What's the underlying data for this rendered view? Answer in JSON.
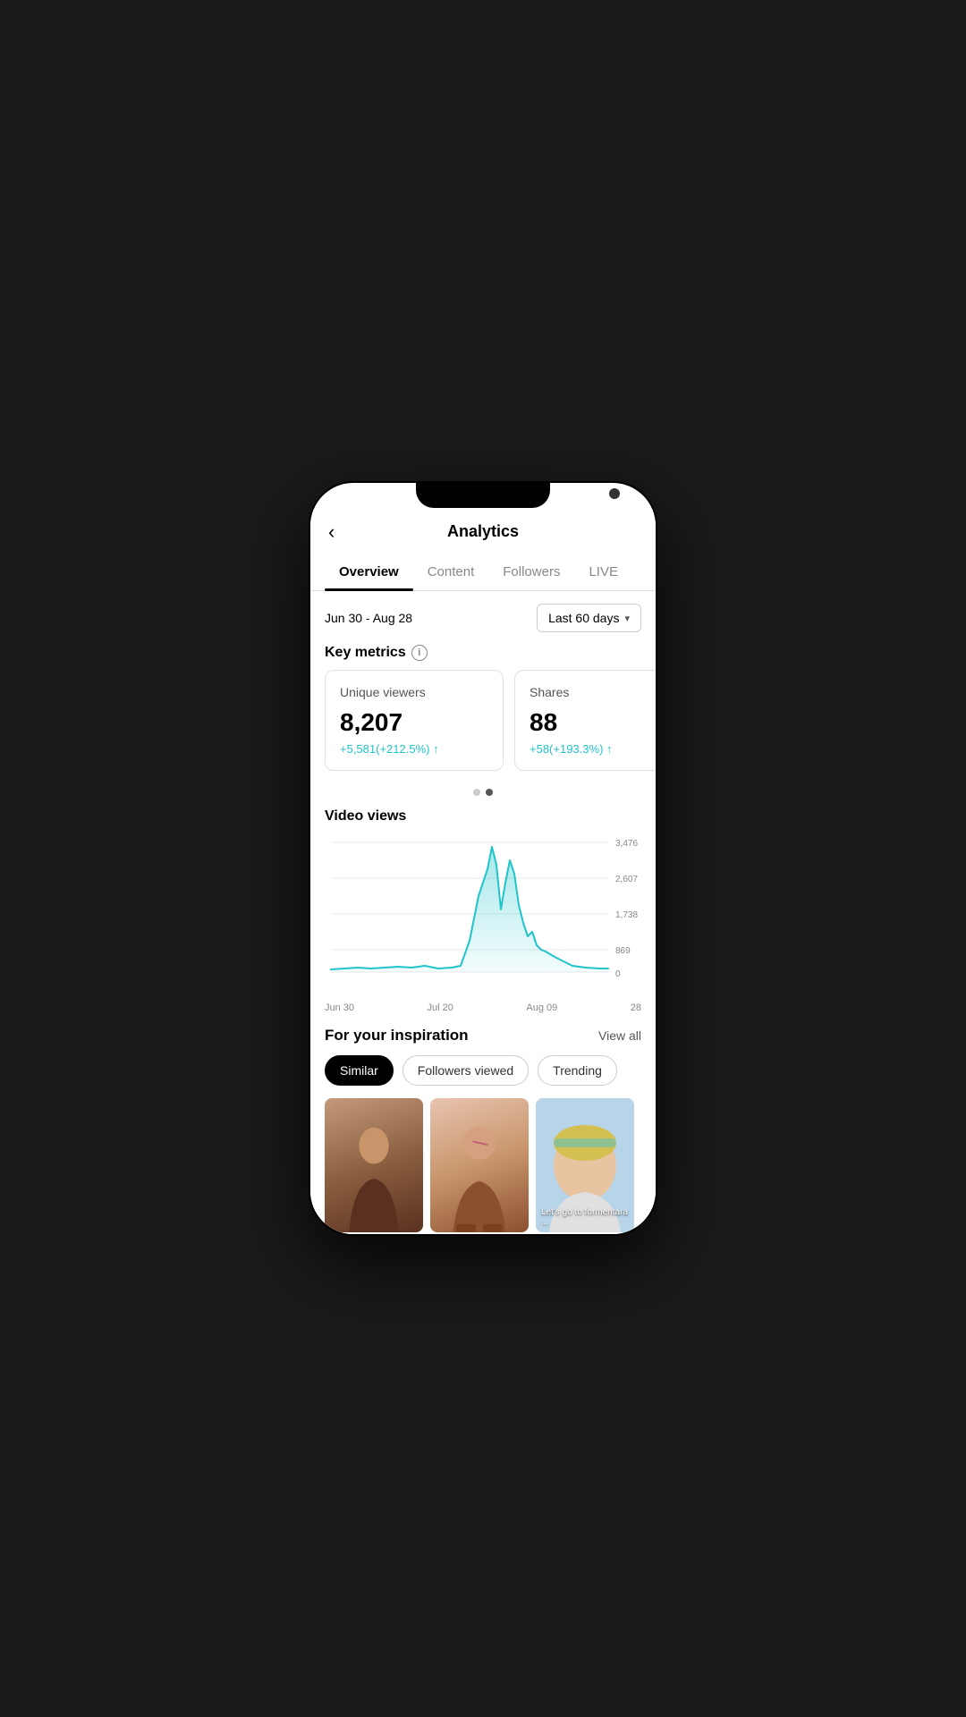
{
  "header": {
    "title": "Analytics",
    "back_label": "‹"
  },
  "tabs": [
    {
      "id": "overview",
      "label": "Overview",
      "active": true
    },
    {
      "id": "content",
      "label": "Content",
      "active": false
    },
    {
      "id": "followers",
      "label": "Followers",
      "active": false
    },
    {
      "id": "live",
      "label": "LIVE",
      "active": false
    }
  ],
  "date_range": {
    "text": "Jun 30 - Aug 28",
    "dropdown_label": "Last 60 days"
  },
  "key_metrics": {
    "title": "Key metrics",
    "cards": [
      {
        "label": "Unique viewers",
        "value": "8,207",
        "change": "+5,581(+212.5%) ↑"
      },
      {
        "label": "Shares",
        "value": "88",
        "change": "+58(+193.3%) ↑"
      }
    ]
  },
  "pagination": {
    "total": 2,
    "active": 1
  },
  "chart": {
    "title": "Video views",
    "y_labels": [
      "3,476",
      "2,607",
      "1,738",
      "869",
      "0"
    ],
    "x_labels": [
      "Jun 30",
      "Jul 20",
      "Aug 09",
      "28"
    ],
    "accent_color": "#20c4cb"
  },
  "inspiration": {
    "title": "For your inspiration",
    "view_all": "View all",
    "filters": [
      {
        "label": "Similar",
        "active": true
      },
      {
        "label": "Followers viewed",
        "active": false
      },
      {
        "label": "Trending",
        "active": false
      }
    ],
    "videos": [
      {
        "id": 1,
        "overlay": ""
      },
      {
        "id": 2,
        "overlay": ""
      },
      {
        "id": 3,
        "overlay": "Let's go to formentara ..."
      }
    ]
  }
}
